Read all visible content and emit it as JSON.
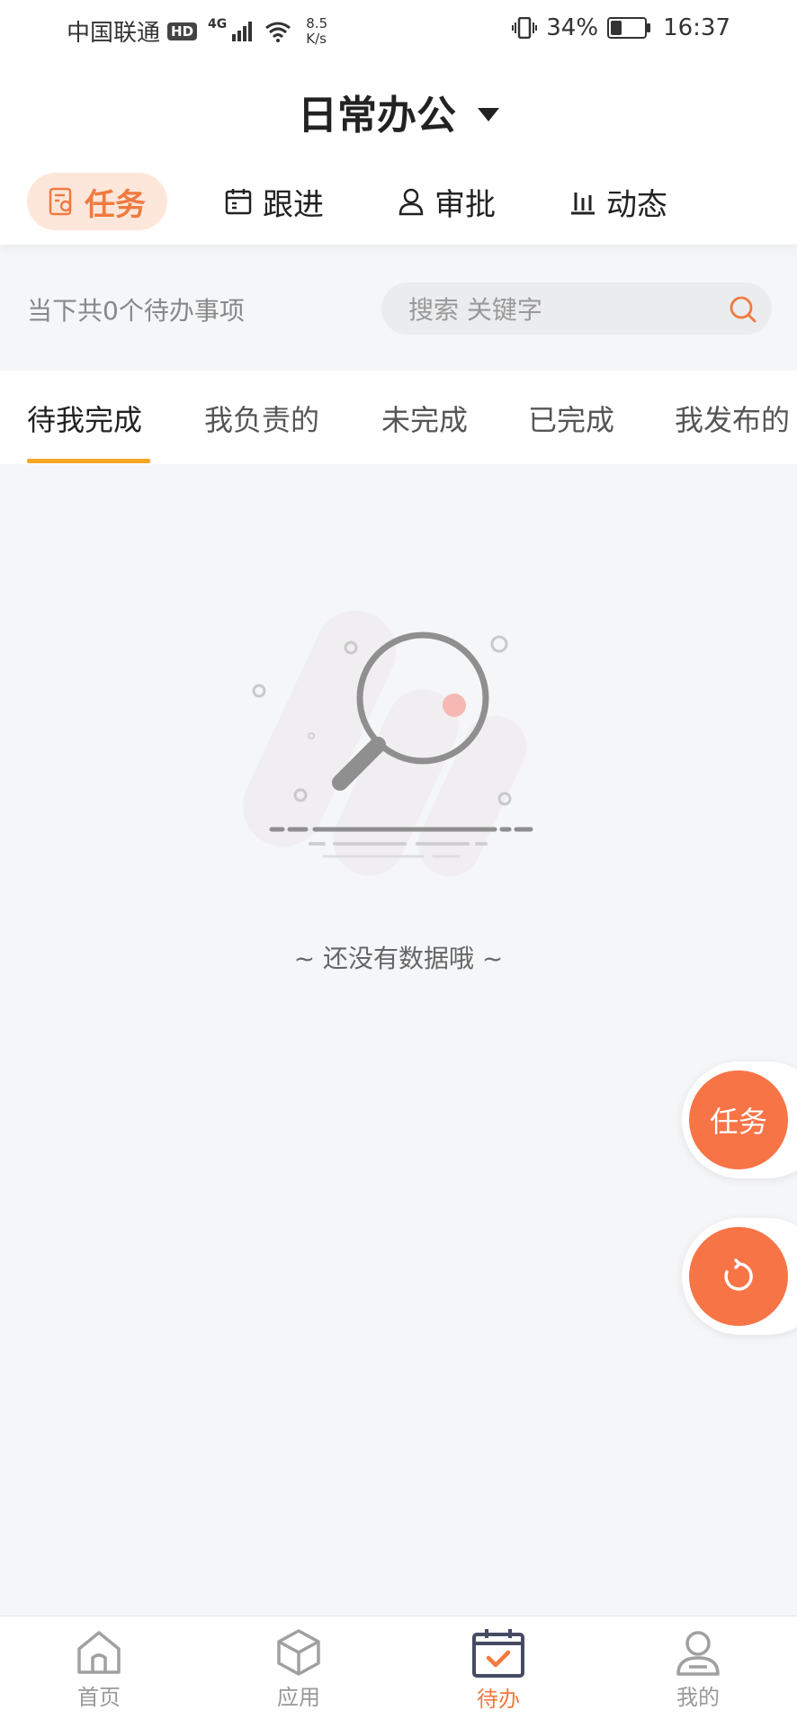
{
  "status_bar": {
    "carrier": "中国联通",
    "hd_badge": "HD",
    "network": "4G",
    "speed_value": "8.5",
    "speed_unit": "K/s",
    "battery_percent": "34%",
    "battery_level": 0.34,
    "time": "16:37"
  },
  "header": {
    "title": "日常办公"
  },
  "module_tabs": [
    {
      "label": "任务",
      "icon": "task-doc-icon",
      "active": true
    },
    {
      "label": "跟进",
      "icon": "calendar-follow-icon",
      "active": false
    },
    {
      "label": "审批",
      "icon": "person-approve-icon",
      "active": false
    },
    {
      "label": "动态",
      "icon": "bar-chart-icon",
      "active": false
    }
  ],
  "summary": {
    "count_text": "当下共0个待办事项"
  },
  "search": {
    "placeholder": "搜索 关键字"
  },
  "filter_tabs": [
    {
      "label": "待我完成",
      "active": true
    },
    {
      "label": "我负责的",
      "active": false
    },
    {
      "label": "未完成",
      "active": false
    },
    {
      "label": "已完成",
      "active": false
    },
    {
      "label": "我发布的",
      "active": false
    }
  ],
  "empty_state": {
    "text": "~ 还没有数据哦 ~"
  },
  "floating_buttons": {
    "task_label": "任务",
    "refresh_icon": "refresh-icon"
  },
  "bottom_nav": [
    {
      "label": "首页",
      "icon": "home-icon",
      "active": false
    },
    {
      "label": "应用",
      "icon": "cube-icon",
      "active": false
    },
    {
      "label": "待办",
      "icon": "calendar-check-icon",
      "active": true
    },
    {
      "label": "我的",
      "icon": "user-icon",
      "active": false
    }
  ],
  "colors": {
    "accent": "#f07a40",
    "fab": "#f77447",
    "tab_underline": "#f5a623",
    "background": "#f5f6f8"
  }
}
